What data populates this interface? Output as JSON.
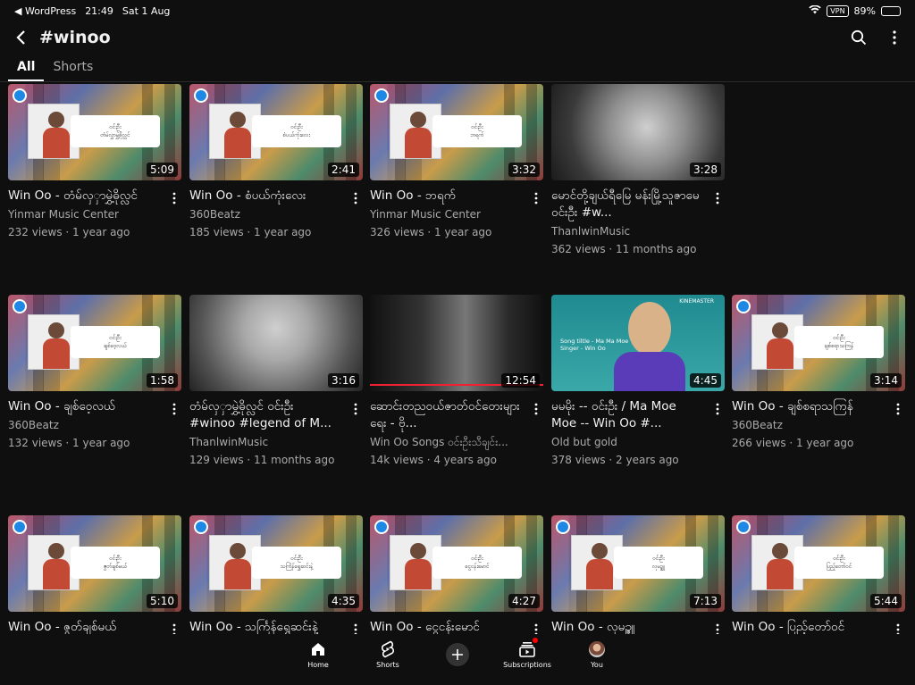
{
  "status": {
    "back_app": "◀ WordPress",
    "time": "21:49",
    "date": "Sat 1 Aug",
    "vpn": "VPN",
    "battery": "89%",
    "battery_level": 0.89
  },
  "header": {
    "title": "#winoo"
  },
  "tabs": [
    {
      "label": "All"
    },
    {
      "label": "Shorts"
    }
  ],
  "videos": [
    {
      "thumb": "poster",
      "label": "ဝင်းဦး\nတံမ်လွှာမွှဲ့ဓိုလ္လင်",
      "duration": "5:09",
      "title": "Win Oo - တံမ်လှှာမွှဲ့ဓိုလ္လင်",
      "channel": "Yinmar Music Center",
      "stats": "232 views · 1 year ago"
    },
    {
      "thumb": "poster",
      "label": "ဝင်းဦး\nစံပယ်ကုံးလေး",
      "duration": "2:41",
      "title": "Win Oo - စံပယ်ကုံးလေး",
      "channel": "360Beatz",
      "stats": "185 views · 1 year ago"
    },
    {
      "thumb": "poster",
      "label": "ဝင်းဦး\nဘရက်",
      "duration": "3:32",
      "title": "Win Oo - ဘရက်",
      "channel": "Yinmar Music Center",
      "stats": "326 views · 1 year ago"
    },
    {
      "thumb": "bw1",
      "duration": "3:28",
      "title": "မောင်တို့ချယ်ရီမြေ မန်းမြို့သူဇာမေ ဝင်းဦး #w...",
      "channel": "ThanlwinMusic",
      "stats": "362 views · 11 months ago"
    },
    {
      "thumb": "poster",
      "label": "ဝင်းဦး\nချစ်ဝေ့လယ်",
      "duration": "1:58",
      "title": "Win Oo - ချစ်ဝေ့လယ်",
      "channel": "360Beatz",
      "stats": "132 views · 1 year ago"
    },
    {
      "thumb": "bw2",
      "duration": "3:16",
      "title": "တံမ်လှှာမွှဲ့ဓိုလ္လင် ဝင်းဦး #winoo #legend of M...",
      "channel": "ThanlwinMusic",
      "stats": "129 views · 11 months ago"
    },
    {
      "thumb": "bw3",
      "duration": "12:54",
      "title": "ဆောင်းတညဝယ်ဇာတ်ဝင်တေးများ ရေး - ဗို...",
      "channel": "Win Oo Songs ဝင်းဦးသီချင်း...",
      "stats": "14k views · 4 years ago"
    },
    {
      "thumb": "teal",
      "duration": "4:45",
      "title": "မမမိုး -- ဝင်းဦး / Ma Moe Moe -- Win Oo #...",
      "channel": "Old but gold",
      "stats": "378 views · 2 years ago",
      "kine": "KINEMASTER",
      "song": "Song tiltle - Ma Ma Moe\nSinger - Win Oo"
    },
    {
      "thumb": "poster",
      "label": "ဝင်းဦး\nချစ်စရာသကြန်",
      "duration": "3:14",
      "title": "Win Oo - ချစ်စရာသကြန်",
      "channel": "360Beatz",
      "stats": "266 views · 1 year ago"
    },
    {
      "thumb": "poster",
      "label": "ဝင်းဦး\nဇွတ်ချစ်မယ်",
      "duration": "5:10",
      "title": "Win Oo - ဇွတ်ချစ်မယ်",
      "channel": "",
      "stats": ""
    },
    {
      "thumb": "poster",
      "label": "ဝင်းဦး\nသင်္ကြန်ရွှေဆင်းနဲ့",
      "duration": "4:35",
      "title": "Win Oo - သင်္ကြန်ရွှေဆင်းနဲ့",
      "channel": "",
      "stats": ""
    },
    {
      "thumb": "poster",
      "label": "ဝင်းဦး\nငွေငန်းမောင်",
      "duration": "4:27",
      "title": "Win Oo - ငွေငန်းမောင်",
      "channel": "",
      "stats": ""
    },
    {
      "thumb": "poster",
      "label": "ဝင်းဦး\nလုမဥ္စူ",
      "duration": "7:13",
      "title": "Win Oo - လုမဥ္စူ",
      "channel": "",
      "stats": ""
    },
    {
      "thumb": "poster",
      "label": "ဝင်းဦး\nပြည့်တော်ဝင်",
      "duration": "5:44",
      "title": "Win Oo - ပြည့်တော်ဝင်",
      "channel": "",
      "stats": ""
    }
  ],
  "nav": [
    {
      "label": "Home",
      "icon": "home-icon"
    },
    {
      "label": "Shorts",
      "icon": "shorts-icon"
    },
    {
      "label": "",
      "icon": "create-icon"
    },
    {
      "label": "Subscriptions",
      "icon": "subscriptions-icon"
    },
    {
      "label": "You",
      "icon": "avatar"
    }
  ],
  "colors": {
    "background": "#0f0f0f",
    "text": "#f1f1f1",
    "muted": "#aaaaaa",
    "badge": "#1e88e5",
    "notification": "#ff0000"
  }
}
